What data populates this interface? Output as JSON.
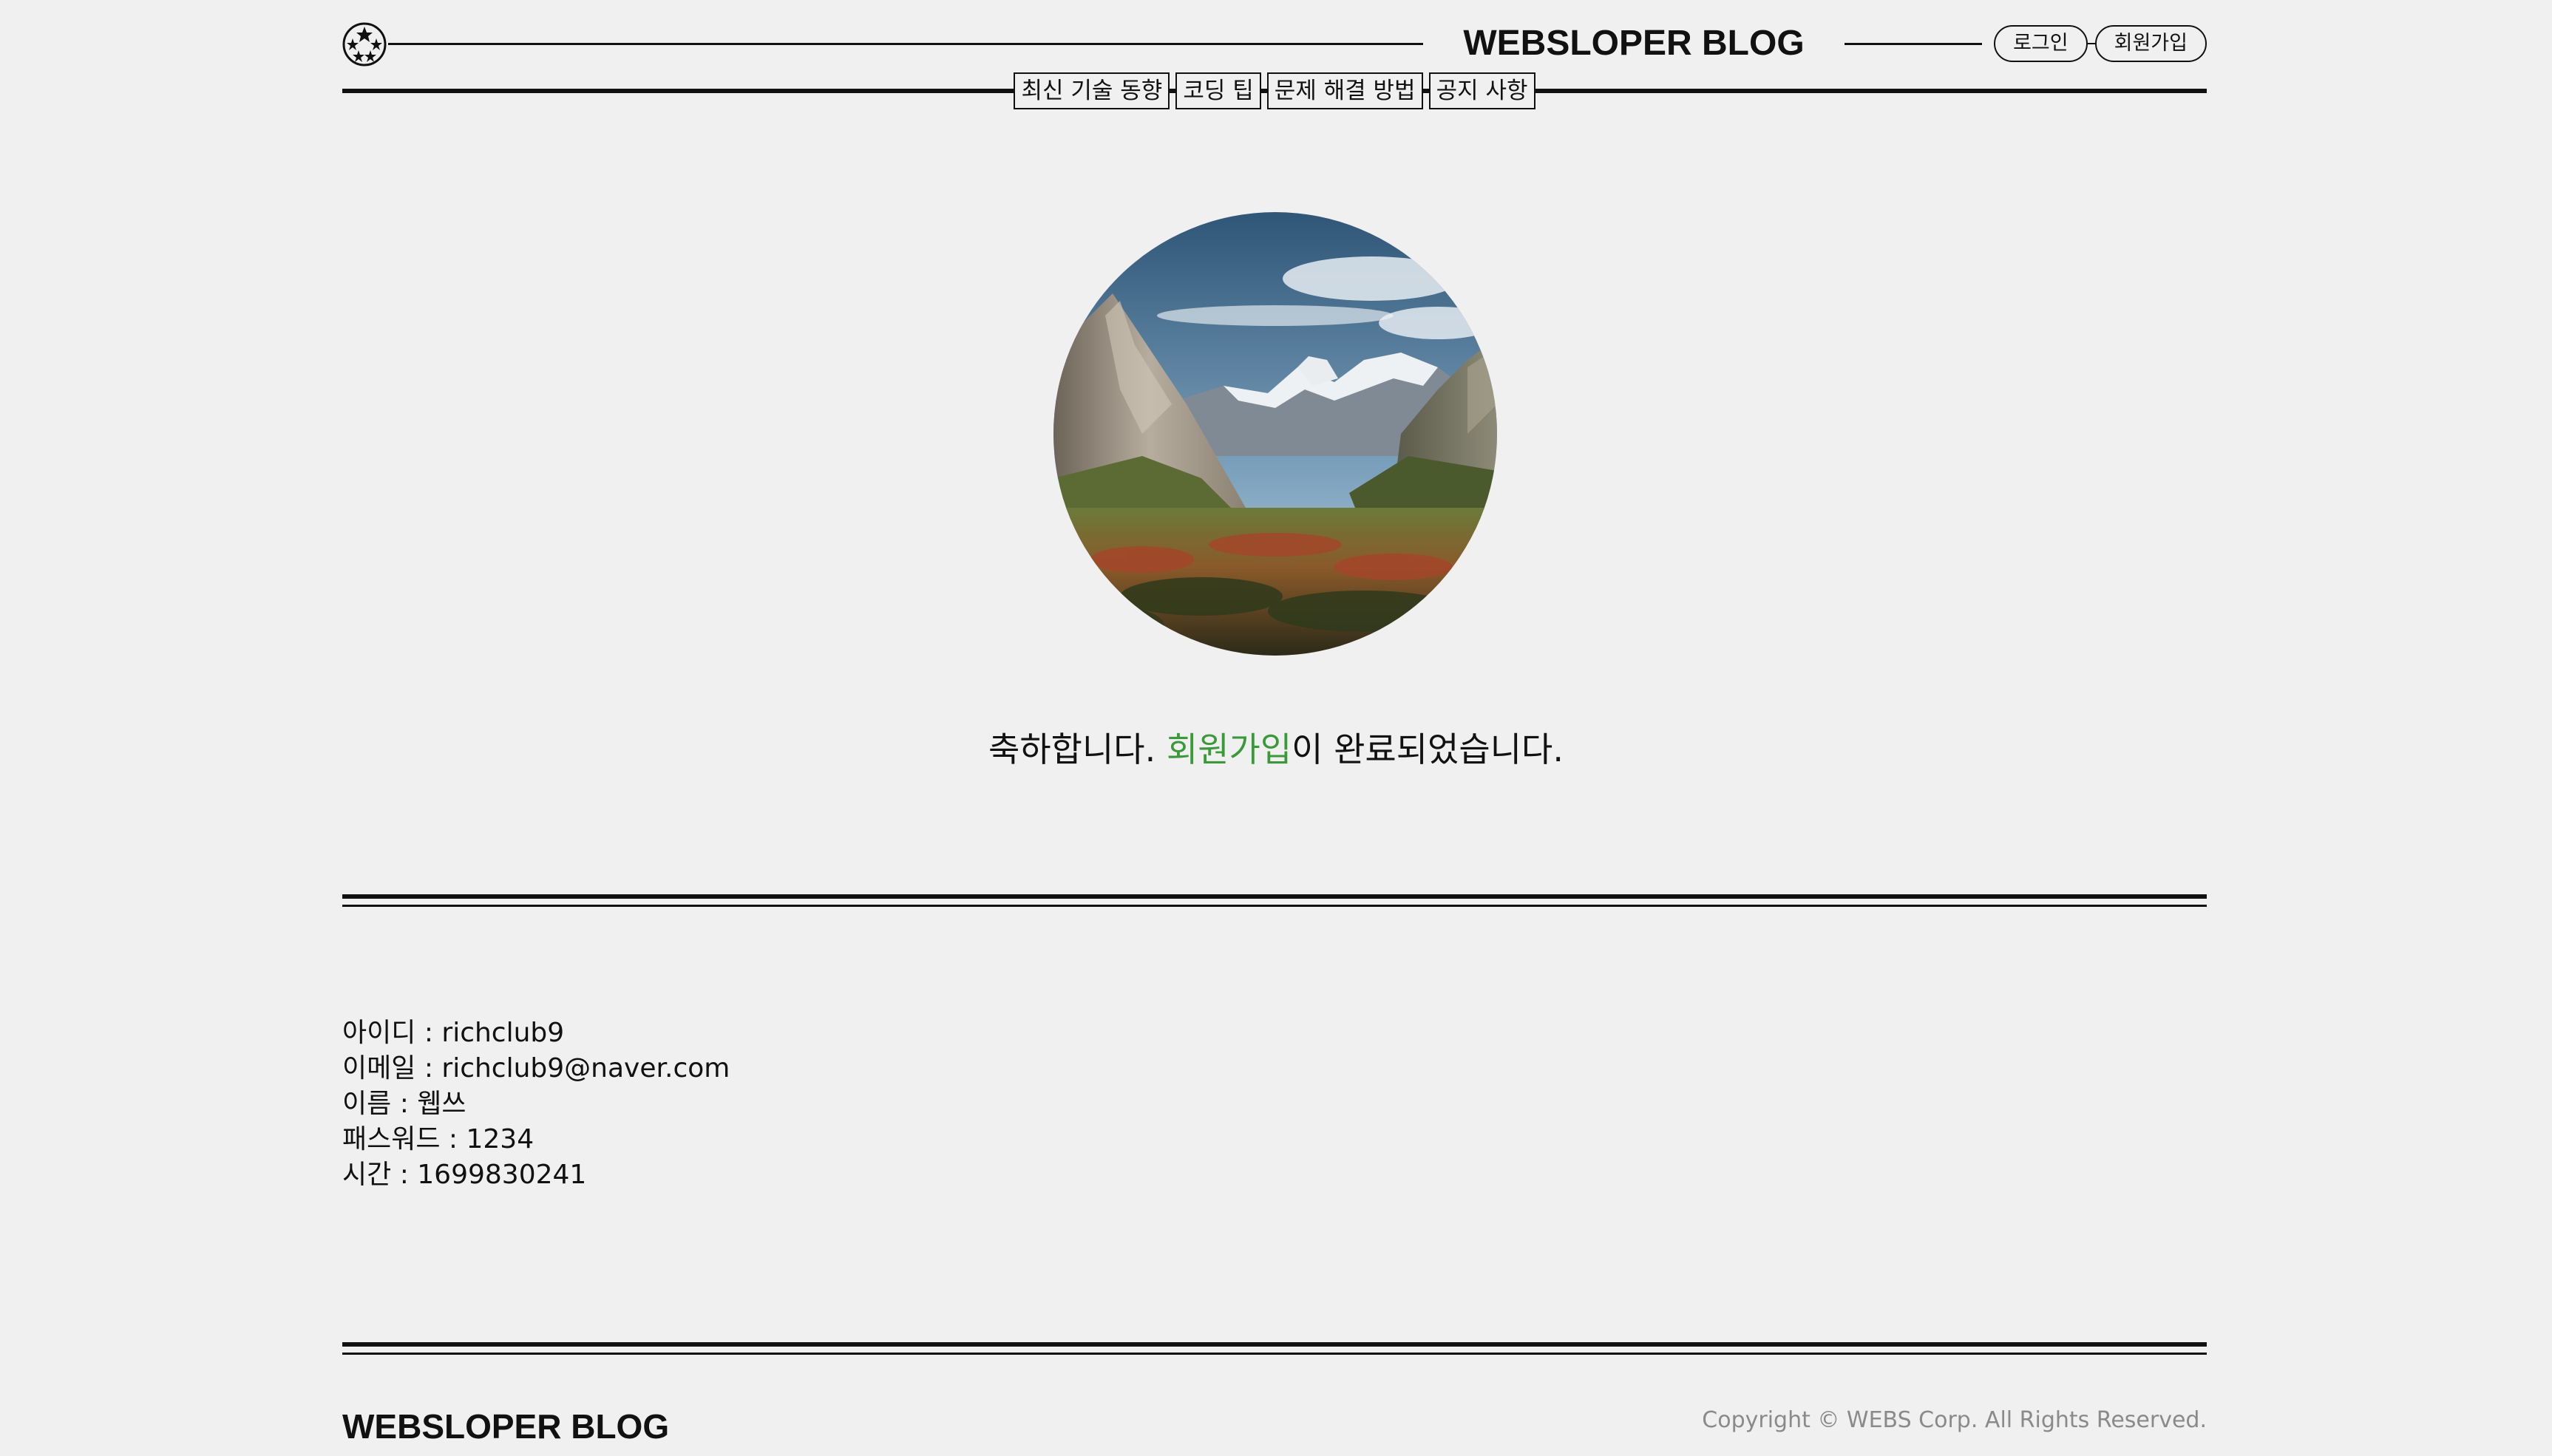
{
  "header": {
    "title": "WEBSLOPER BLOG",
    "auth": {
      "login_label": "로그인",
      "signup_label": "회원가입"
    },
    "nav": [
      {
        "label": "최신 기술 동향"
      },
      {
        "label": "코딩 팁"
      },
      {
        "label": "문제 해결 방법"
      },
      {
        "label": "공지 사항"
      }
    ],
    "logo_icon": "star-circle-icon"
  },
  "hero": {
    "image": "mountain-valley-landscape",
    "message_prefix": "축하합니다. ",
    "message_highlight": "회원가입",
    "message_suffix": "이 완료되었습니다.",
    "highlight_color": "#3a9a3a"
  },
  "info": [
    {
      "label": "아이디",
      "sep": " : ",
      "value": "richclub9"
    },
    {
      "label": "이메일",
      "sep": " : ",
      "value": "richclub9@naver.com"
    },
    {
      "label": "이름",
      "sep": " : ",
      "value": "웹쓰"
    },
    {
      "label": "패스워드",
      "sep": " : ",
      "value": "1234"
    },
    {
      "label": "시간",
      "sep": " : ",
      "value": "1699830241"
    }
  ],
  "footer": {
    "title": "WEBSLOPER BLOG",
    "copyright": "Copyright © WEBS Corp. All Rights Reserved."
  },
  "colors": {
    "background": "#f0f0f0",
    "ink": "#111111",
    "muted": "#8a8a8a"
  }
}
